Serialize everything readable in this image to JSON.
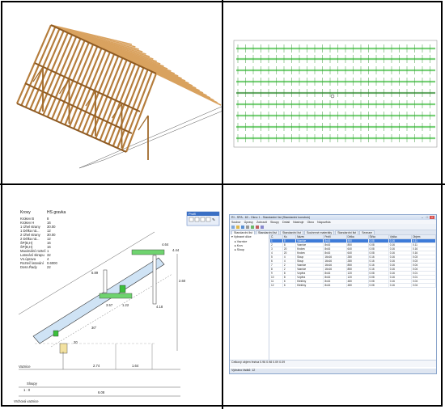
{
  "params": {
    "title": "Krovy",
    "subtitle": "HS gravka",
    "rows": [
      {
        "label": "Krokev B",
        "value": "8"
      },
      {
        "label": "Krokev H",
        "value": "16"
      },
      {
        "label": "1 Úhel strany",
        "value": "30.00"
      },
      {
        "label": "1 Délka ná...",
        "value": "12"
      },
      {
        "label": "2 Úhel strany",
        "value": "30.00"
      },
      {
        "label": "2 Délka ná...",
        "value": "12"
      },
      {
        "label": "ŠP(B,H)",
        "value": "16"
      },
      {
        "label": "ŠP(B,H)",
        "value": "16"
      },
      {
        "label": "Maximální rozteč",
        "value": "1"
      }
    ],
    "rows2": [
      {
        "label": "Latování skrapu",
        "value": "32"
      },
      {
        "label": "Vn.úprava",
        "value": "4"
      },
      {
        "label": "Rozteč latování",
        "value": "0.6000"
      },
      {
        "label": "Dosn.Řady",
        "value": "22"
      }
    ]
  },
  "toolbox": {
    "title": "Profil"
  },
  "truss_labels": {
    "dims_top": [
      "4.64",
      "4.44",
      "5.89",
      "2.60",
      "1.22",
      "3.57",
      "4.18"
    ],
    "dims_bottom": [
      "2.74",
      "1.64",
      "6.08"
    ],
    "section_a": "20",
    "vaznice": "Vaznice",
    "sloupy": "Sloupy",
    "vrch": "Vrchová vaznice",
    "scale": "1 : 0",
    "angle": "30°"
  },
  "window": {
    "title": "RI - SPA - 60 - Okno 1 - Standardní list (Standardní konstruk)",
    "menu": [
      "Soubor",
      "Úpravy",
      "Zobrazit",
      "Sloupy",
      "Detail",
      "Nástroje",
      "Okno",
      "Nápověda"
    ],
    "tabs": [
      "Standardní list",
      "Standardní list",
      "Standardní list",
      "Souhrnné materiály",
      "Standardní list",
      "Seznam"
    ],
    "tree_root": "Vybrané dílce",
    "tree_items": [
      "Vaznice",
      "Krov",
      "Sloup"
    ],
    "columns": [
      "Č.",
      "Ks",
      "Název",
      "Profil",
      "Délka",
      "Šířka",
      "Výška",
      "Objem"
    ],
    "rows": [
      [
        "1",
        "8",
        "Vaznice",
        "8x16",
        "850",
        "0.08",
        "0.16",
        "0.11"
      ],
      [
        "2",
        "8",
        "Vaznice",
        "8x16",
        "850",
        "0.08",
        "0.16",
        "0.11"
      ],
      [
        "3",
        "20",
        "Krokev",
        "8x16",
        "640",
        "0.08",
        "0.16",
        "0.16"
      ],
      [
        "4",
        "20",
        "Krokev",
        "8x16",
        "640",
        "0.08",
        "0.16",
        "0.16"
      ],
      [
        "5",
        "4",
        "Sloup",
        "16x16",
        "280",
        "0.16",
        "0.16",
        "0.03"
      ],
      [
        "6",
        "4",
        "Sloup",
        "16x16",
        "280",
        "0.16",
        "0.16",
        "0.03"
      ],
      [
        "7",
        "2",
        "Vaznice",
        "16x16",
        "850",
        "0.16",
        "0.16",
        "0.04"
      ],
      [
        "8",
        "2",
        "Vaznice",
        "16x16",
        "850",
        "0.16",
        "0.16",
        "0.04"
      ],
      [
        "9",
        "8",
        "Vzpěra",
        "8x16",
        "120",
        "0.08",
        "0.16",
        "0.01"
      ],
      [
        "10",
        "8",
        "Vzpěra",
        "8x16",
        "120",
        "0.08",
        "0.16",
        "0.01"
      ],
      [
        "11",
        "6",
        "Kleštiny",
        "8x16",
        "480",
        "0.08",
        "0.16",
        "0.04"
      ],
      [
        "12",
        "6",
        "Kleštiny",
        "8x16",
        "480",
        "0.08",
        "0.16",
        "0.04"
      ]
    ],
    "footer1": "Celkový objem řeziva",
    "footer_values": [
      "0.96",
      "0.98",
      "0.09",
      "0.09"
    ],
    "status": "Vybráno řádků: 12"
  }
}
